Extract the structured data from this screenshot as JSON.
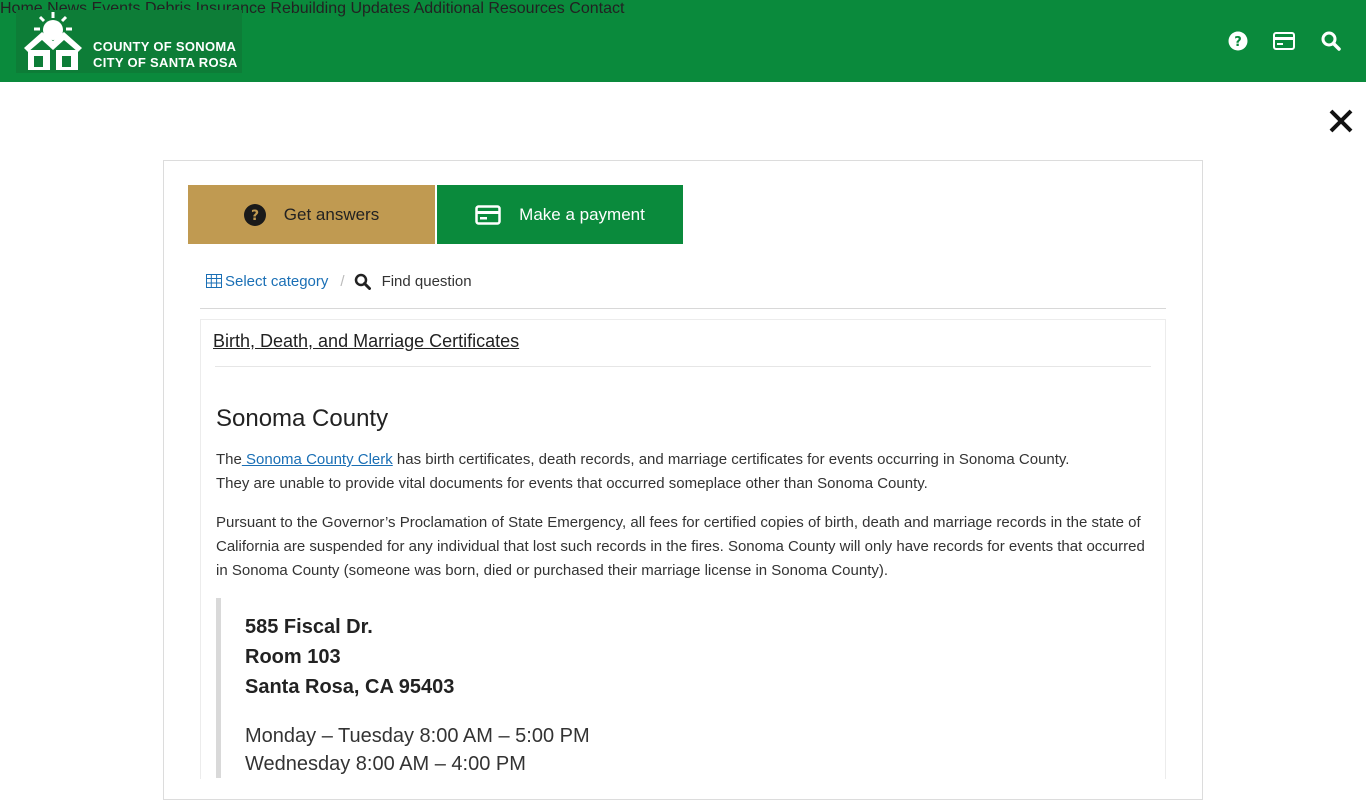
{
  "header": {
    "logo_line1": "COUNTY OF SONOMA",
    "logo_line2": "CITY OF SANTA ROSA",
    "nav": [
      "Home",
      "News",
      "Events",
      "Debris Insurance",
      "Rebuilding",
      "Updates",
      "Additional Resources",
      "Contact"
    ],
    "icons": [
      "help-icon",
      "payment-card-icon",
      "search-icon"
    ],
    "brand_color": "#0a8a3c"
  },
  "panel": {
    "get_answers_label": "Get answers",
    "make_payment_label": "Make a payment",
    "crumb_category": "Select category",
    "crumb_separator": "/",
    "crumb_find": "Find question",
    "accent_gold": "#c09a51"
  },
  "article": {
    "title": "Birth, Death, and Marriage Certificates",
    "heading": "Sonoma County",
    "p1_prefix": "The",
    "p1_link": " Sonoma County Clerk",
    "p1_rest": " has birth certificates, death records, and marriage certificates for events occurring in Sonoma County.",
    "p1_line2": "They are unable to provide vital documents for events that occurred someplace other than Sonoma County.",
    "p2": "Pursuant to the Governor’s Proclamation of State Emergency, all fees for certified copies of birth, death and marriage records in the state of California are suspended for any individual that lost such records in the fires.  Sonoma County will only have records for events that occurred in Sonoma County (someone was born, died or purchased their marriage license in Sonoma County).",
    "address": [
      "585 Fiscal Dr.",
      "Room 103",
      "Santa Rosa, CA 95403"
    ],
    "hours": [
      "Monday – Tuesday 8:00 AM – 5:00 PM",
      "Wednesday 8:00 AM – 4:00 PM"
    ]
  }
}
